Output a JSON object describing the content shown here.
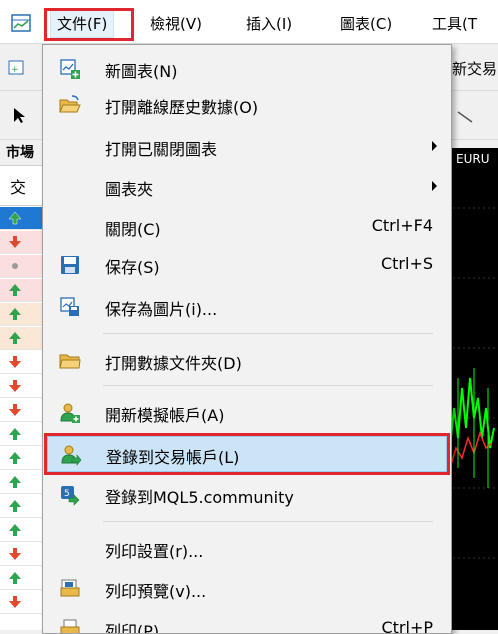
{
  "menubar": {
    "items": [
      {
        "label": "文件(F)",
        "active": true
      },
      {
        "label": "檢視(V)"
      },
      {
        "label": "插入(I)"
      },
      {
        "label": "圖表(C)"
      },
      {
        "label": "工具(T"
      }
    ]
  },
  "toolbar": {
    "partial_label": "新交易"
  },
  "side_panel": {
    "header": "市場",
    "sub_label": "交"
  },
  "chart": {
    "symbol_partial": "EURU"
  },
  "file_menu": {
    "items": [
      {
        "label": "新圖表(N)",
        "icon": "new-chart-icon"
      },
      {
        "label": "打開離線歷史數據(O)",
        "icon": "open-folder-icon"
      },
      {
        "label": "打開已關閉圖表",
        "has_submenu": true
      },
      {
        "label": "圖表夾",
        "has_submenu": true
      },
      {
        "label": "關閉(C)",
        "shortcut": "Ctrl+F4"
      },
      {
        "label": "保存(S)",
        "shortcut": "Ctrl+S",
        "icon": "save-icon"
      },
      {
        "label": "保存為圖片(i)...",
        "icon": "save-picture-icon"
      },
      {
        "label": "打開數據文件夾(D)",
        "icon": "data-folder-icon"
      },
      {
        "label": "開新模擬帳戶(A)",
        "icon": "new-demo-account-icon"
      },
      {
        "label": "登錄到交易帳戶(L)",
        "icon": "login-trade-account-icon",
        "selected": true
      },
      {
        "label": "登錄到MQL5.community",
        "icon": "mql5-login-icon"
      },
      {
        "label": "列印設置(r)..."
      },
      {
        "label": "列印預覽(v)...",
        "icon": "print-preview-icon"
      },
      {
        "label": "列印(P)",
        "shortcut": "Ctrl+P",
        "icon": "print-icon"
      }
    ]
  },
  "colors": {
    "highlight": "#e0272e",
    "selected_bg": "#cce4f7",
    "up_arrow": "#2ea44f",
    "down_arrow": "#e04a2c"
  }
}
